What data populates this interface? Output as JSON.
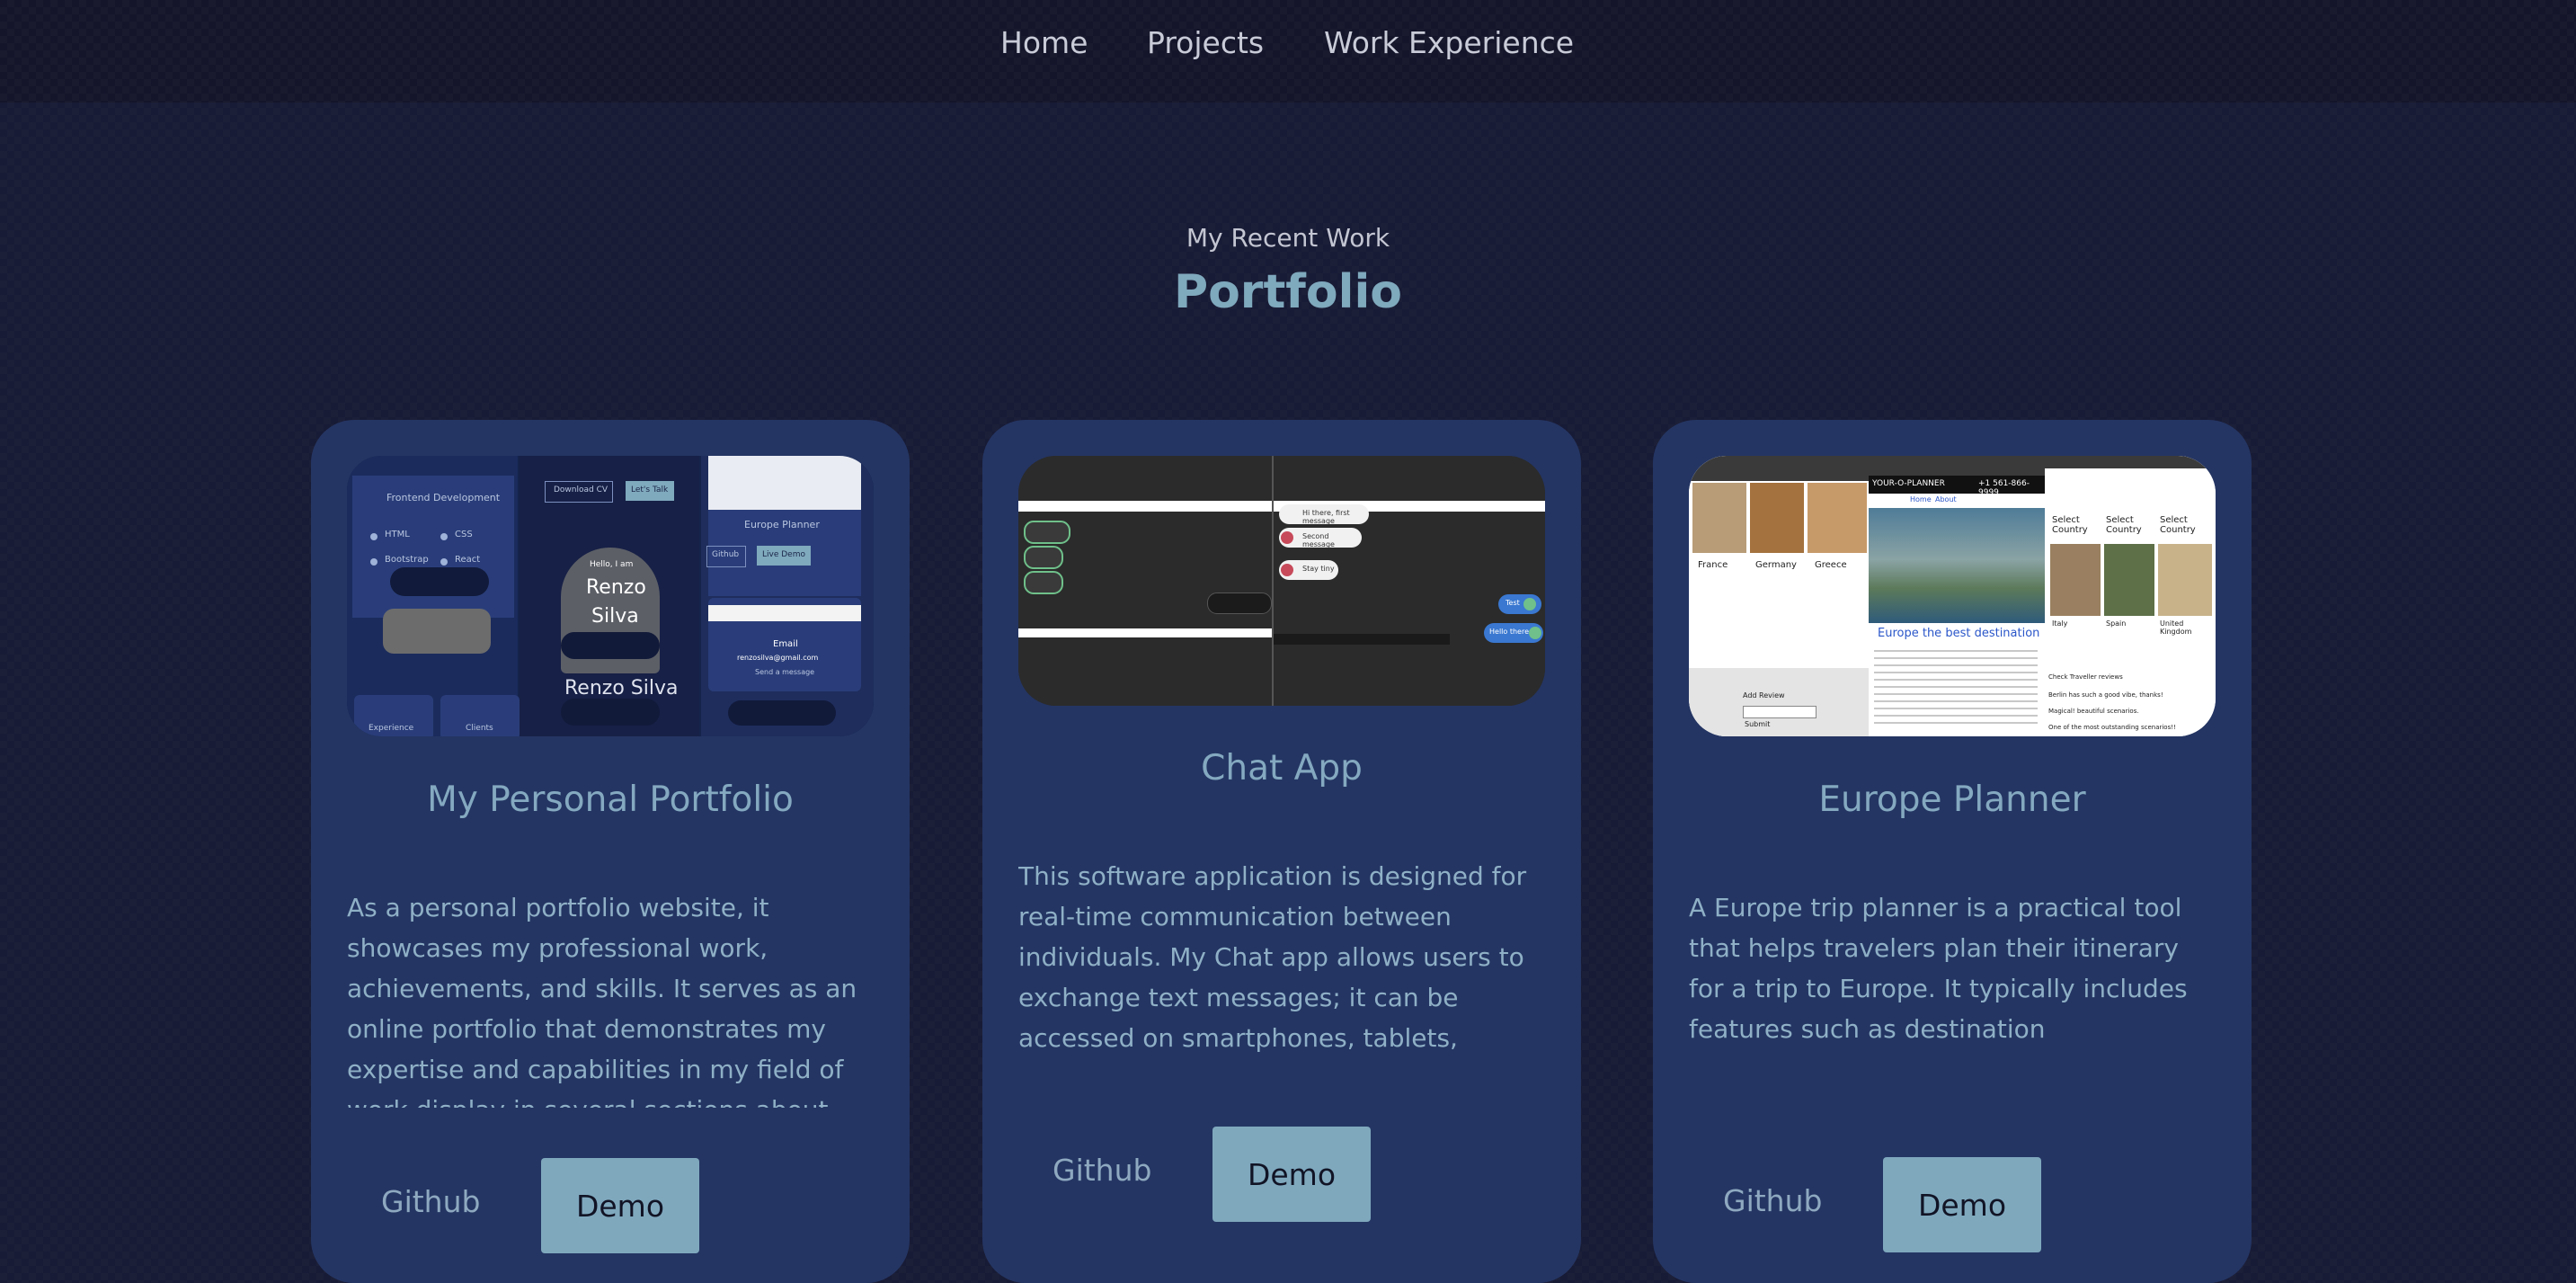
{
  "nav": {
    "home": "Home",
    "projects": "Projects",
    "work_experience": "Work Experience"
  },
  "section": {
    "subtitle": "My Recent Work",
    "title": "Portfolio"
  },
  "cards": [
    {
      "title": "My Personal Portfolio",
      "description": "As a personal portfolio website, it showcases my professional work, achievements, and skills. It serves as an online portfolio that demonstrates my expertise and capabilities in my field of work display in several sections about me, my work experience, education, and skills.",
      "github_label": "Github",
      "demo_label": "Demo",
      "screenshot": {
        "frontend_heading": "Frontend Development",
        "skills": [
          "HTML",
          "CSS",
          "Bootstrap",
          "React"
        ],
        "download_cv": "Download CV",
        "lets_talk": "Let's Talk",
        "hello": "Hello, I am",
        "name_line1": "Renzo",
        "name_line2": "Silva",
        "name_full": "Renzo Silva",
        "europe_planner": "Europe Planner",
        "github": "Github",
        "live_demo": "Live Demo",
        "email_label": "Email",
        "email_value": "renzosilva@gmail.com",
        "send_message": "Send a message",
        "experience": "Experience",
        "clients": "Clients"
      }
    },
    {
      "title": "Chat App",
      "description": "This software application is designed for real-time communication between individuals. My Chat app allows users to exchange text messages; it can be accessed on smartphones, tablets, desktop computers, and other internet-enabled devices. My chat app requires users to",
      "github_label": "Github",
      "demo_label": "Demo",
      "screenshot": {
        "msg_first": "Hi there, first message",
        "msg_second": "Second message",
        "msg_third": "Stay tiny",
        "msg_test": "Test",
        "msg_hello": "Hello there"
      }
    },
    {
      "title": "Europe Planner",
      "description": "A Europe trip planner is a practical tool that helps travelers plan their itinerary for a trip to Europe. It typically includes features such as destination recommendations.",
      "github_label": "Github",
      "demo_label": "Demo",
      "screenshot": {
        "countries_left": [
          "France",
          "Germany",
          "Greece"
        ],
        "brand": "YOUR-O-PLANNER",
        "phone": "+1 561-866-9999",
        "nav_home": "Home",
        "nav_about": "About",
        "headline": "Europe the best destination",
        "select_country": "Select Country",
        "countries_right": [
          "Italy",
          "Spain",
          "United Kingdom"
        ],
        "add_review": "Add Review",
        "submit": "Submit",
        "check_traveller": "Check Traveller reviews",
        "review_1": "Berlin has such a good vibe, thanks!",
        "review_2": "Magical! beautiful scenarios.",
        "review_3": "One of the most outstanding scenarios!!"
      }
    }
  ],
  "colors": {
    "background": "#181b35",
    "nav_background": "#14152a",
    "card": "#243563",
    "accent": "#7fa9bd",
    "card_text": "#8fb0c6"
  }
}
